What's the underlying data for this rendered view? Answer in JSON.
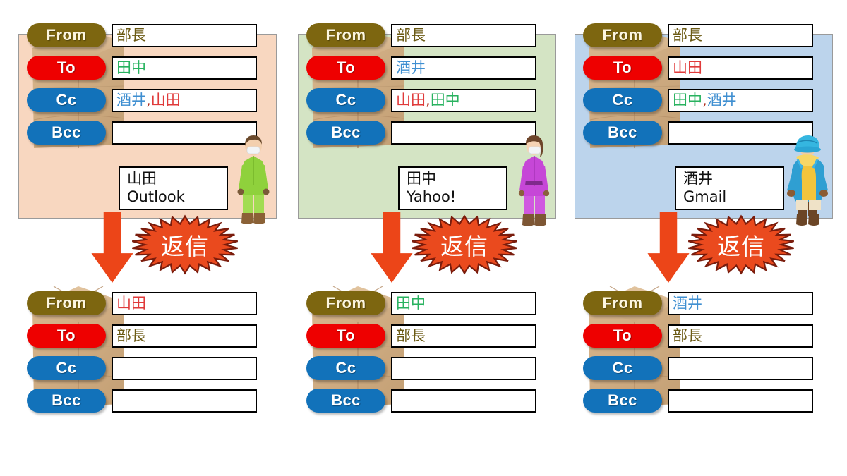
{
  "colors": {
    "from_pill": "#7d6610",
    "to_pill": "#ee0000",
    "cc_pill": "#1272ba",
    "bcc_pill": "#1272ba",
    "panel_1_bg": "#f8d7c0",
    "panel_2_bg": "#d4e4c4",
    "panel_3_bg": "#bcd4ec",
    "burst_fill": "#ea4a1e",
    "burst_outline": "#7a1c0c",
    "arrow_fill": "#ec4518",
    "name_boss": "#6b5a14",
    "name_tanaka": "#28b25f",
    "name_sakai": "#3f8fd1",
    "name_yamada": "#e03a3a"
  },
  "labels": {
    "from": "From",
    "to": "To",
    "cc": "Cc",
    "bcc": "Bcc"
  },
  "reply_badge": "返信",
  "columns": [
    {
      "panel_color": "#f8d7c0",
      "original": {
        "from": [
          {
            "text": "部長",
            "color": "#6b5a14"
          }
        ],
        "to": [
          {
            "text": "田中",
            "color": "#28b25f"
          }
        ],
        "cc": [
          {
            "text": "酒井",
            "color": "#3f8fd1"
          },
          {
            "text": ",",
            "color": "#b03020"
          },
          {
            "text": "山田",
            "color": "#e03a3a"
          }
        ],
        "bcc": []
      },
      "note": {
        "name": "山田",
        "client": "Outlook"
      },
      "character": "green-masked-person",
      "reply": {
        "from": [
          {
            "text": "山田",
            "color": "#e03a3a"
          }
        ],
        "to": [
          {
            "text": "部長",
            "color": "#6b5a14"
          }
        ],
        "cc": [],
        "bcc": []
      }
    },
    {
      "panel_color": "#d4e4c4",
      "original": {
        "from": [
          {
            "text": "部長",
            "color": "#6b5a14"
          }
        ],
        "to": [
          {
            "text": "酒井",
            "color": "#3f8fd1"
          }
        ],
        "cc": [
          {
            "text": "山田",
            "color": "#e03a3a"
          },
          {
            "text": ",",
            "color": "#b03020"
          },
          {
            "text": "田中",
            "color": "#28b25f"
          }
        ],
        "bcc": []
      },
      "note": {
        "name": "田中",
        "client": "Yahoo!"
      },
      "character": "purple-masked-person",
      "reply": {
        "from": [
          {
            "text": "田中",
            "color": "#28b25f"
          }
        ],
        "to": [
          {
            "text": "部長",
            "color": "#6b5a14"
          }
        ],
        "cc": [],
        "bcc": []
      }
    },
    {
      "panel_color": "#bcd4ec",
      "original": {
        "from": [
          {
            "text": "部長",
            "color": "#6b5a14"
          }
        ],
        "to": [
          {
            "text": "山田",
            "color": "#e03a3a"
          }
        ],
        "cc": [
          {
            "text": "田中",
            "color": "#28b25f"
          },
          {
            "text": ",",
            "color": "#b03020"
          },
          {
            "text": "酒井",
            "color": "#3f8fd1"
          }
        ],
        "bcc": []
      },
      "note": {
        "name": "酒井",
        "client": "Gmail"
      },
      "character": "blue-gold-wizard",
      "reply": {
        "from": [
          {
            "text": "酒井",
            "color": "#3f8fd1"
          }
        ],
        "to": [
          {
            "text": "部長",
            "color": "#6b5a14"
          }
        ],
        "cc": [],
        "bcc": []
      }
    }
  ]
}
